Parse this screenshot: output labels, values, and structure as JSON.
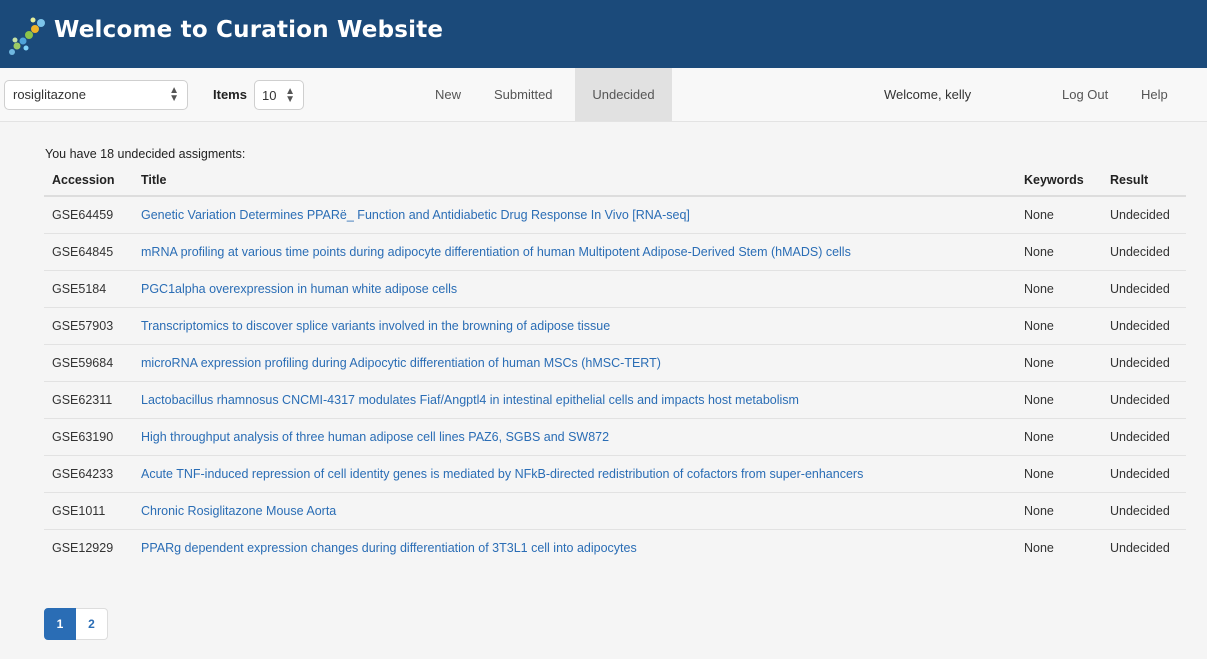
{
  "header": {
    "title": "Welcome to Curation Website",
    "logo_icon": "dna-helix-icon",
    "background": "#1b4a7a"
  },
  "nav": {
    "search_select": {
      "value": "rosiglitazone"
    },
    "items_label": "Items",
    "items_select": {
      "value": "10"
    },
    "tabs": [
      {
        "label": "New",
        "active": false
      },
      {
        "label": "Submitted",
        "active": false
      },
      {
        "label": "Undecided",
        "active": true
      }
    ],
    "welcome": "Welcome, kelly",
    "logout": "Log Out",
    "help": "Help"
  },
  "main": {
    "summary": "You have 18 undecided assigments:",
    "table": {
      "headers": [
        "Accession",
        "Title",
        "Keywords",
        "Result"
      ],
      "rows": [
        {
          "accession": "GSE64459",
          "title": "Genetic Variation Determines PPARë_ Function and Antidiabetic Drug Response In Vivo [RNA-seq]",
          "keywords": "None",
          "result": "Undecided"
        },
        {
          "accession": "GSE64845",
          "title": "mRNA profiling at various time points during adipocyte differentiation of human Multipotent Adipose-Derived Stem (hMADS) cells",
          "keywords": "None",
          "result": "Undecided"
        },
        {
          "accession": "GSE5184",
          "title": "PGC1alpha overexpression in human white adipose cells",
          "keywords": "None",
          "result": "Undecided"
        },
        {
          "accession": "GSE57903",
          "title": "Transcriptomics to discover splice variants involved in the browning of adipose tissue",
          "keywords": "None",
          "result": "Undecided"
        },
        {
          "accession": "GSE59684",
          "title": "microRNA expression profiling during Adipocytic differentiation of human MSCs (hMSC-TERT)",
          "keywords": "None",
          "result": "Undecided"
        },
        {
          "accession": "GSE62311",
          "title": "Lactobacillus rhamnosus CNCMI-4317 modulates Fiaf/Angptl4 in intestinal epithelial cells and impacts host metabolism",
          "keywords": "None",
          "result": "Undecided"
        },
        {
          "accession": "GSE63190",
          "title": "High throughput analysis of three human adipose cell lines PAZ6, SGBS and SW872",
          "keywords": "None",
          "result": "Undecided"
        },
        {
          "accession": "GSE64233",
          "title": "Acute TNF-induced repression of cell identity genes is mediated by NFkB-directed redistribution of cofactors from super-enhancers",
          "keywords": "None",
          "result": "Undecided"
        },
        {
          "accession": "GSE1011",
          "title": "Chronic Rosiglitazone Mouse Aorta",
          "keywords": "None",
          "result": "Undecided"
        },
        {
          "accession": "GSE12929",
          "title": "PPARg dependent expression changes during differentiation of 3T3L1 cell into adipocytes",
          "keywords": "None",
          "result": "Undecided"
        }
      ]
    },
    "pagination": {
      "pages": [
        "1",
        "2"
      ],
      "current": "1"
    }
  },
  "colors": {
    "link": "#2a6db5",
    "active_tab": "#e1e1e1",
    "content_bg": "#f5f5f5"
  }
}
